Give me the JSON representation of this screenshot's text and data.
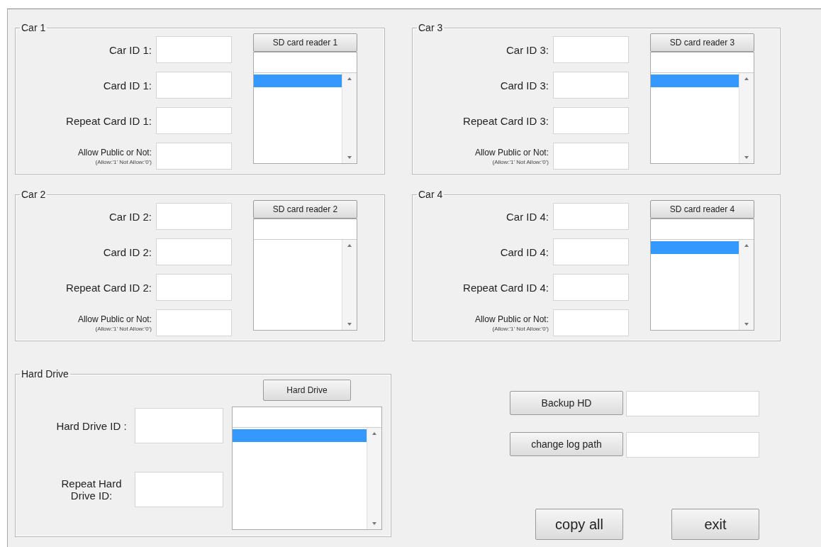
{
  "cars": [
    {
      "title": "Car 1",
      "fields": [
        {
          "label": "Car ID 1:"
        },
        {
          "label": "Card ID 1:"
        },
        {
          "label": "Repeat Card ID 1:"
        },
        {
          "label": "Allow Public or Not:",
          "note": "(Allow:'1' Not Allow:'0')"
        }
      ],
      "reader_button": "SD card reader 1",
      "list_highlight": true
    },
    {
      "title": "Car 2",
      "fields": [
        {
          "label": "Car ID 2:"
        },
        {
          "label": "Card ID 2:"
        },
        {
          "label": "Repeat Card ID 2:"
        },
        {
          "label": "Allow Public or Not:",
          "note": "(Allow:'1' Not Allow:'0')"
        }
      ],
      "reader_button": "SD card reader 2",
      "list_highlight": false
    },
    {
      "title": "Car 3",
      "fields": [
        {
          "label": "Car ID 3:"
        },
        {
          "label": "Card ID 3:"
        },
        {
          "label": "Repeat Card ID 3:"
        },
        {
          "label": "Allow Public or Not:",
          "note": "(Allow:'1' Not Allow:'0')"
        }
      ],
      "reader_button": "SD card reader 3",
      "list_highlight": true
    },
    {
      "title": "Car 4",
      "fields": [
        {
          "label": "Car ID 4:"
        },
        {
          "label": "Card ID 4:"
        },
        {
          "label": "Repeat Card ID 4:"
        },
        {
          "label": "Allow Public or Not:",
          "note": "(Allow:'1' Not Allow:'0')"
        }
      ],
      "reader_button": "SD card reader 4",
      "list_highlight": true
    }
  ],
  "hard_drive": {
    "title": "Hard Drive",
    "button": "Hard Drive",
    "fields": [
      {
        "label": "Hard Drive ID :"
      },
      {
        "label": "Repeat Hard Drive ID:"
      }
    ],
    "list_highlight": true
  },
  "actions": [
    {
      "button": "Backup HD"
    },
    {
      "button": "change log path"
    }
  ],
  "buttons": [
    "copy all",
    "exit"
  ]
}
